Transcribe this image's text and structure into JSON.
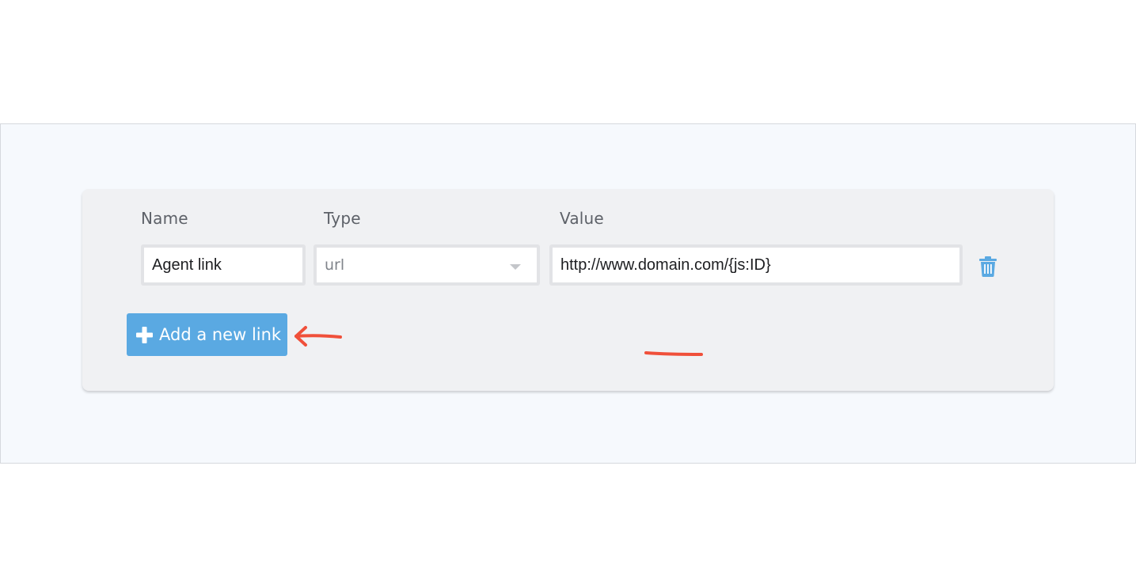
{
  "labels": {
    "name": "Name",
    "type": "Type",
    "value": "Value"
  },
  "link_row": {
    "name_value": "Agent link",
    "type_selected": "url",
    "value_value": "http://www.domain.com/{js:ID}"
  },
  "actions": {
    "add_link_label": "Add a new link",
    "add_icon": "plus-icon",
    "delete_icon": "trash-icon"
  },
  "colors": {
    "accent": "#5aa9e2",
    "annotation": "#f0503a",
    "card_bg": "#f0f1f3",
    "page_bg": "#f6f9fd"
  },
  "annotations": {
    "underline": "red-underline-mark",
    "arrow": "red-arrow-mark"
  }
}
